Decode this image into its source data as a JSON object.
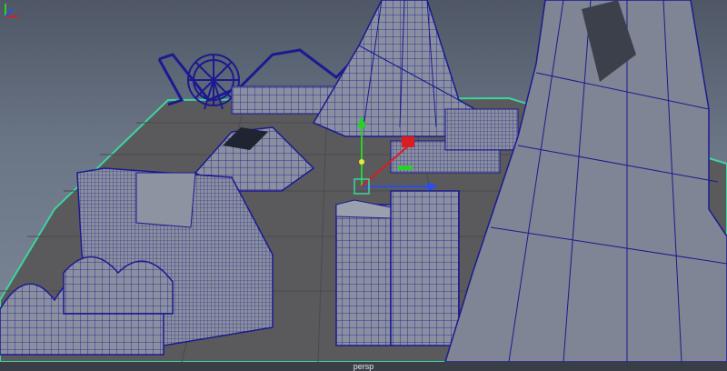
{
  "viewport": {
    "camera_label": "persp",
    "colors": {
      "background": "#6a7585",
      "grid": "#555a5f",
      "wireframe": "#1c1a8f",
      "shade": "#8d93a0",
      "grid_edge": "#3cd4a0",
      "manipulator_x": "#d81e1e",
      "manipulator_y": "#2ad02a",
      "manipulator_z": "#2a4ee8",
      "pivot": "#e8e83a"
    },
    "icons": {
      "move_manipulator": "move-manipulator-icon",
      "axis_indicator": "axis-indicator-icon"
    }
  }
}
